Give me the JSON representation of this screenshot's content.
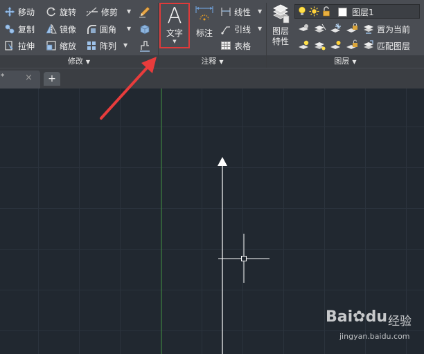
{
  "modify_panel": {
    "title": "修改",
    "tools": {
      "move": "移动",
      "rotate": "旋转",
      "trim": "修剪",
      "copy": "复制",
      "mirror": "镜像",
      "fillet": "圆角",
      "stretch": "拉伸",
      "scale": "缩放",
      "array": "阵列"
    }
  },
  "annotation_panel": {
    "title": "注释",
    "text_glyph": "A",
    "text_label": "文字",
    "dimension_label": "标注",
    "linear_label": "线性",
    "leader_label": "引线",
    "table_label": "表格"
  },
  "layers_panel": {
    "title": "图层",
    "properties_line1": "图层",
    "properties_line2": "特性",
    "current_layer": "图层1",
    "set_current": "置为当前",
    "match_layer": "匹配图层"
  },
  "tabs": {
    "doc_marker": "*",
    "close": "×",
    "new_tab": "+"
  },
  "watermark": {
    "brand_main": "Bai",
    "brand_paw": "du",
    "experience": "经验",
    "url": "jingyan.baidu.com"
  },
  "colors": {
    "ribbon": "#4a4d53",
    "canvas": "#212830",
    "highlight_box": "#e03a3a",
    "arrow": "#e83c3c",
    "y_axis": "#3f8f3f"
  }
}
